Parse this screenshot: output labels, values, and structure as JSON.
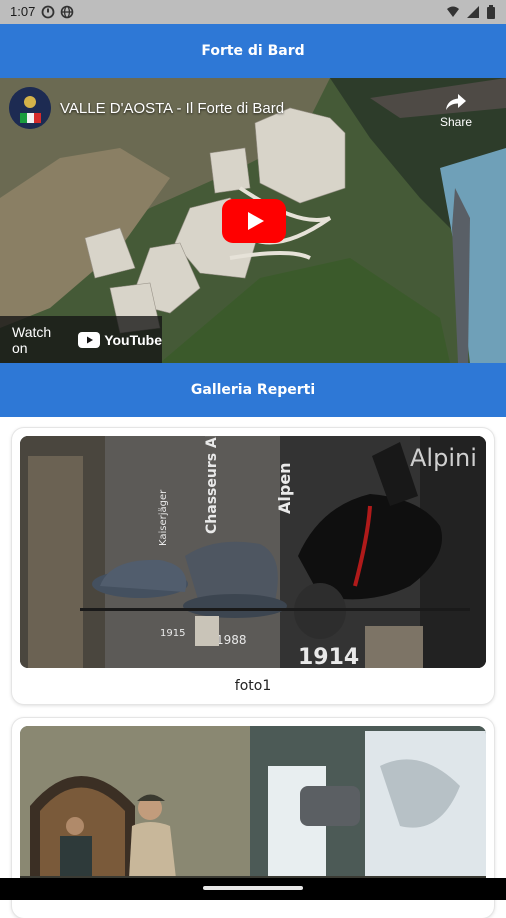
{
  "status_bar": {
    "time": "1:07"
  },
  "app_bar": {
    "title": "Forte di Bard"
  },
  "video": {
    "title": "VALLE D'AOSTA - Il Forte di Bard",
    "share_label": "Share",
    "watch_on_label": "Watch on",
    "youtube_label": "YouTube"
  },
  "gallery": {
    "title": "Galleria Reperti",
    "items": [
      {
        "caption": "foto1",
        "wall_texts": [
          "Kaiserjäger",
          "Chasseurs Alpins",
          "Alpen",
          "Alpini",
          "1914",
          "1915",
          "1988"
        ]
      },
      {
        "caption": ""
      }
    ]
  },
  "colors": {
    "primary": "#2e78d6",
    "youtube_red": "#ff0000"
  }
}
